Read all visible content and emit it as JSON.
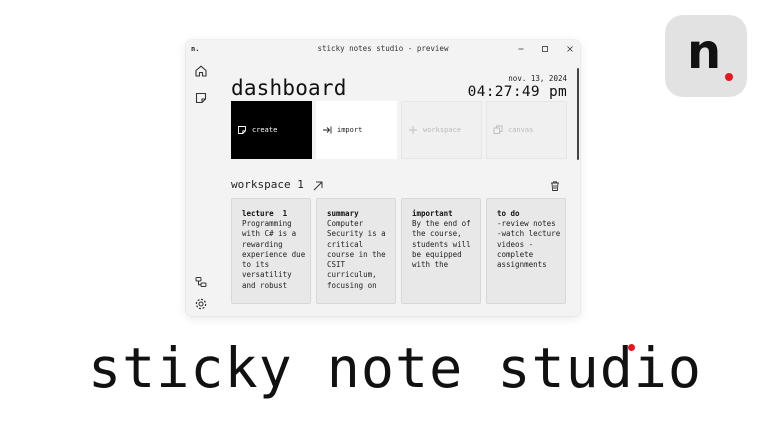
{
  "window": {
    "logo": "n.",
    "title": "sticky notes studio - preview"
  },
  "header": {
    "title": "dashboard",
    "date": "nov. 13, 2024",
    "time": "04:27:49 pm"
  },
  "actions": {
    "create": "create",
    "import": "import",
    "workspace": "workspace",
    "canvas": "canvas"
  },
  "workspace": {
    "title": "workspace 1",
    "notes": [
      {
        "title": "lecture  1",
        "body": "Programming with C# is a rewarding experience due to its versatility and robust"
      },
      {
        "title": "summary",
        "body": "Computer Security is a critical course in the CSIT curriculum, focusing on"
      },
      {
        "title": "important",
        "body": "By the end of the course, students will be equipped with the"
      },
      {
        "title": "to do",
        "body": "-review notes -watch lecture videos -complete assignments"
      }
    ]
  },
  "branding": {
    "badge_letter": "n",
    "tagline": "sticky note studio",
    "accent_color": "#e8141e"
  },
  "icons": {
    "nav": [
      "home-icon",
      "sticky-note-icon",
      "flow-icon",
      "gear-icon"
    ],
    "workspace": [
      "arrow-up-right-icon",
      "trash-icon"
    ]
  }
}
